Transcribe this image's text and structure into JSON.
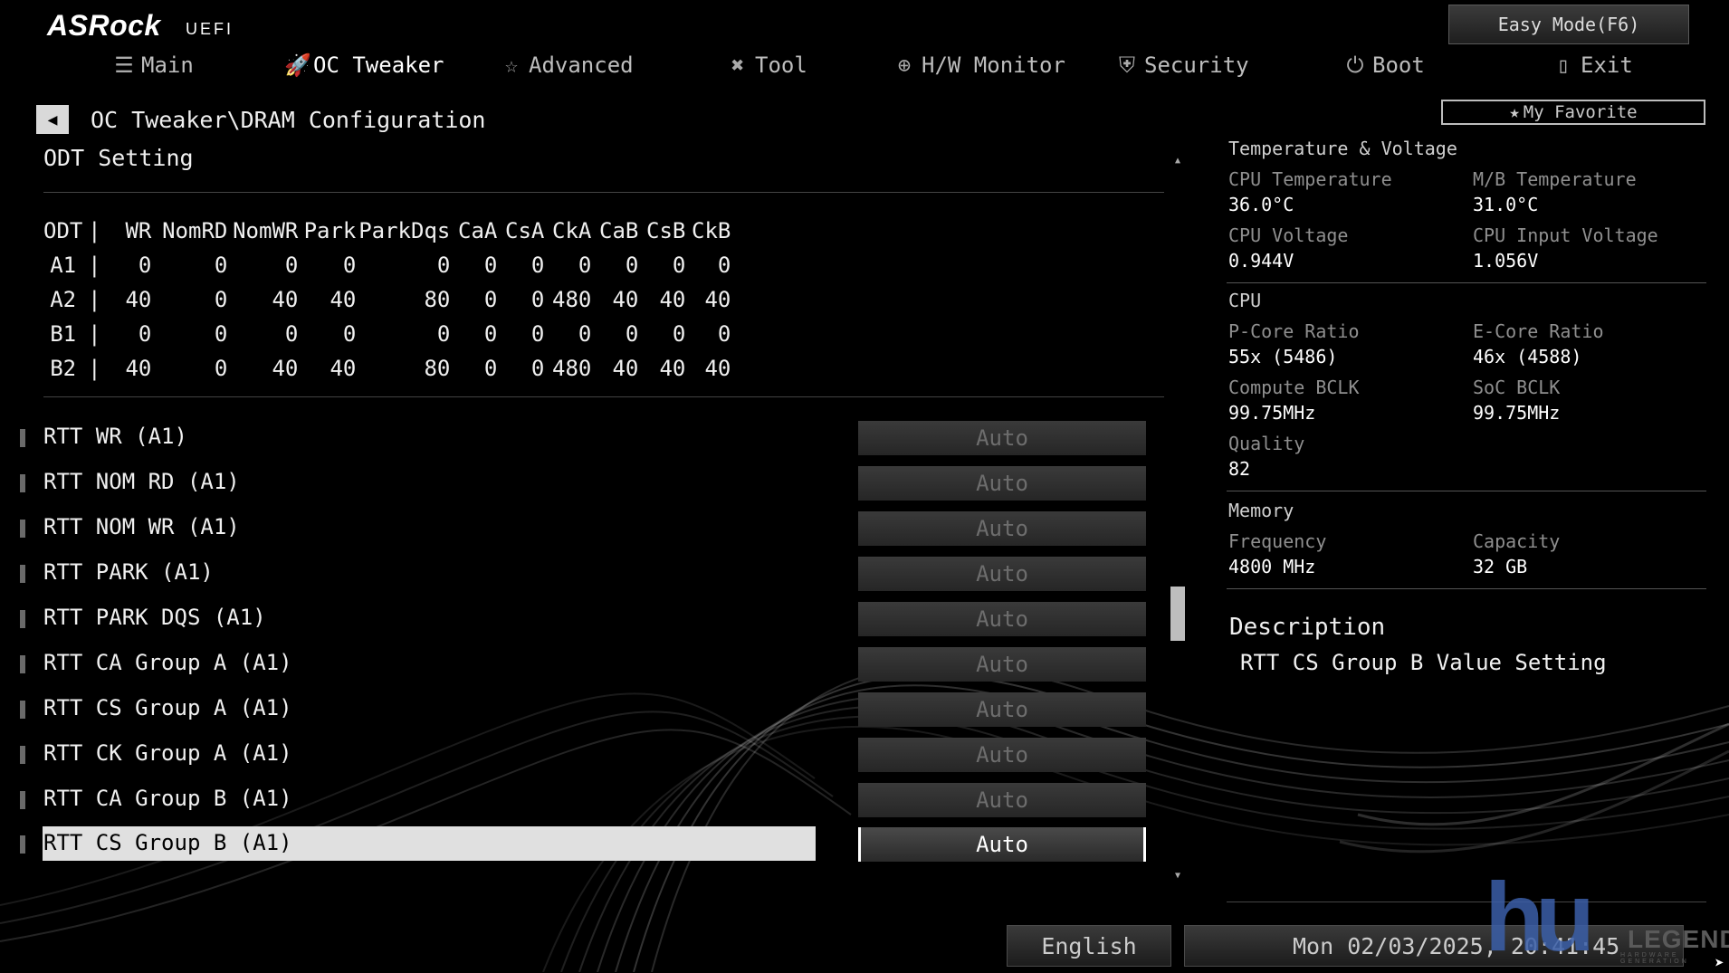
{
  "brand": {
    "logo": "ASRock",
    "sub": "UEFI"
  },
  "easy_mode": "Easy Mode(F6)",
  "nav": [
    {
      "label": "Main",
      "icon": "list-icon"
    },
    {
      "label": "OC Tweaker",
      "icon": "rocket-icon",
      "active": true
    },
    {
      "label": "Advanced",
      "icon": "star-icon"
    },
    {
      "label": "Tool",
      "icon": "tools-icon"
    },
    {
      "label": "H/W Monitor",
      "icon": "crosshair-icon"
    },
    {
      "label": "Security",
      "icon": "shield-icon"
    },
    {
      "label": "Boot",
      "icon": "power-icon"
    },
    {
      "label": "Exit",
      "icon": "exit-door-icon"
    }
  ],
  "breadcrumb": "OC Tweaker\\DRAM Configuration",
  "my_favorite": "My Favorite",
  "section_title": "ODT Setting",
  "odt_table": {
    "headers": [
      "ODT",
      "|",
      "WR",
      "NomRD",
      "NomWR",
      "Park",
      "ParkDqs",
      "CaA",
      "CsA",
      "CkA",
      "CaB",
      "CsB",
      "CkB"
    ],
    "rows": [
      [
        "A1",
        "|",
        "0",
        "0",
        "0",
        "0",
        "0",
        "0",
        "0",
        "0",
        "0",
        "0",
        "0"
      ],
      [
        "A2",
        "|",
        "40",
        "0",
        "40",
        "40",
        "80",
        "0",
        "0",
        "480",
        "40",
        "40",
        "40"
      ],
      [
        "B1",
        "|",
        "0",
        "0",
        "0",
        "0",
        "0",
        "0",
        "0",
        "0",
        "0",
        "0",
        "0"
      ],
      [
        "B2",
        "|",
        "40",
        "0",
        "40",
        "40",
        "80",
        "0",
        "0",
        "480",
        "40",
        "40",
        "40"
      ]
    ]
  },
  "settings": [
    {
      "label": "RTT WR (A1)",
      "value": "Auto"
    },
    {
      "label": "RTT NOM RD (A1)",
      "value": "Auto"
    },
    {
      "label": "RTT NOM WR (A1)",
      "value": "Auto"
    },
    {
      "label": "RTT PARK (A1)",
      "value": "Auto"
    },
    {
      "label": "RTT PARK DQS (A1)",
      "value": "Auto"
    },
    {
      "label": "RTT CA Group A (A1)",
      "value": "Auto"
    },
    {
      "label": "RTT CS Group A (A1)",
      "value": "Auto"
    },
    {
      "label": "RTT CK Group A (A1)",
      "value": "Auto"
    },
    {
      "label": "RTT CA Group B (A1)",
      "value": "Auto"
    },
    {
      "label": "RTT CS Group B (A1)",
      "value": "Auto",
      "selected": true
    }
  ],
  "right_panel": {
    "temp_voltage": {
      "title": "Temperature & Voltage",
      "cpu_temp_label": "CPU Temperature",
      "cpu_temp": "36.0°C",
      "mb_temp_label": "M/B Temperature",
      "mb_temp": "31.0°C",
      "cpu_volt_label": "CPU Voltage",
      "cpu_volt": "0.944V",
      "cpu_in_volt_label": "CPU Input Voltage",
      "cpu_in_volt": "1.056V"
    },
    "cpu": {
      "title": "CPU",
      "pcore_label": "P-Core Ratio",
      "pcore": "55x (5486)",
      "ecore_label": "E-Core Ratio",
      "ecore": "46x (4588)",
      "bclk_label": "Compute BCLK",
      "bclk": "99.75MHz",
      "soc_label": "SoC BCLK",
      "soc": "99.75MHz",
      "quality_label": "Quality",
      "quality": "82"
    },
    "memory": {
      "title": "Memory",
      "freq_label": "Frequency",
      "freq": "4800 MHz",
      "cap_label": "Capacity",
      "cap": "32 GB"
    },
    "description_title": "Description",
    "description": "RTT CS Group B Value Setting"
  },
  "footer": {
    "language": "English",
    "datetime": "Mon 02/03/2025, 20:41:45"
  },
  "watermark": {
    "mark": "hu",
    "word": "LEGEND",
    "tag": "HARDWARE GENERATION"
  },
  "colors": {
    "background": "#000000",
    "highlight": "#e0e0e0",
    "watermark_blue": "#3b5fa8"
  }
}
